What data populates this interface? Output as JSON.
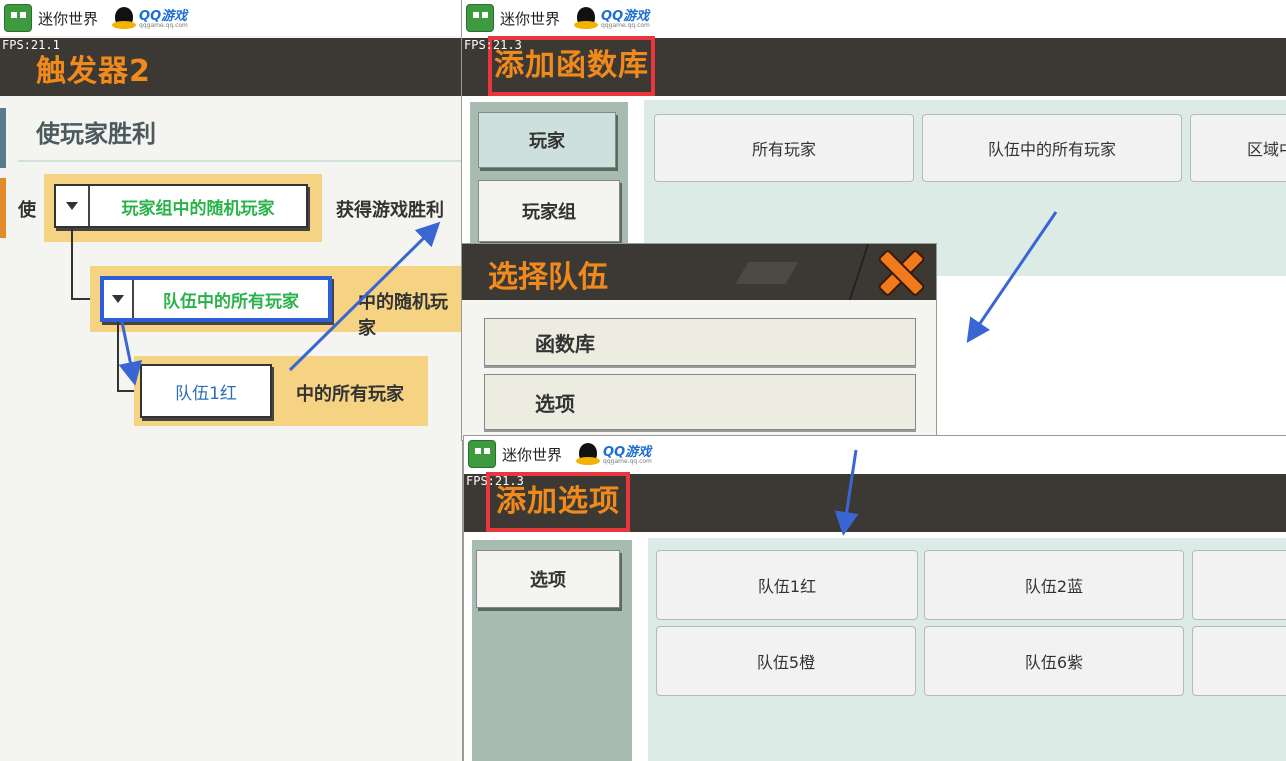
{
  "app": {
    "name": "迷你世界",
    "qq_name": "QQ游戏",
    "qq_site": "qqgame.qq.com"
  },
  "colors": {
    "header_bg": "#3c3934",
    "header_title": "#f08a1c",
    "annotation_red": "#e8363c",
    "annotation_blue": "#2e5fd8",
    "slot_yellow": "#f6d283",
    "selector_green": "#2bb24a",
    "panel_green": "#dcebe6"
  },
  "win1": {
    "fps": "FPS:21.1",
    "header_title": "触发器2",
    "condition_title": "使玩家胜利",
    "prefix": "使",
    "selector1_label": "玩家组中的随机玩家",
    "suffix1": "获得游戏胜利",
    "selector2_label": "队伍中的所有玩家",
    "suffix2": "中的随机玩家",
    "selector3_label": "队伍1红",
    "suffix3": "中的所有玩家"
  },
  "win2": {
    "fps": "FPS:21.3",
    "header_title": "添加函数库",
    "categories": [
      "玩家",
      "玩家组"
    ],
    "options": [
      "所有玩家",
      "队伍中的所有玩家",
      "区域中的所有玩家"
    ]
  },
  "dialog": {
    "title": "选择队伍",
    "rows": [
      "函数库",
      "选项"
    ]
  },
  "win3": {
    "fps": "FPS:21.3",
    "header_title": "添加选项",
    "categories": [
      "选项"
    ],
    "options": [
      "队伍1红",
      "队伍2蓝",
      "队伍5橙",
      "队伍6紫"
    ]
  }
}
